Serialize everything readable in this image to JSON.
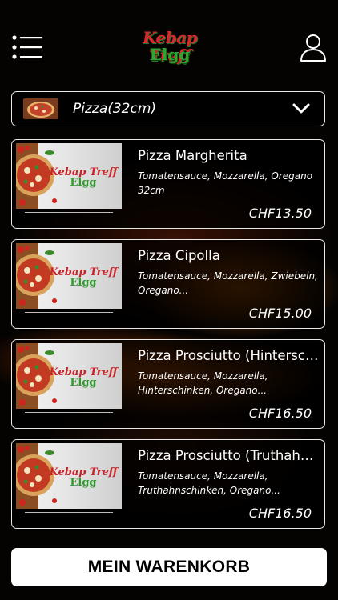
{
  "header": {
    "logo_line1": "Kebap Treff",
    "logo_line2": "Elgg",
    "menu_icon": "hamburger-list-icon",
    "user_icon": "user-icon"
  },
  "category": {
    "selected": "Pizza(32cm)",
    "icon": "chevron-down-icon"
  },
  "thumb_logo": {
    "line1": "Kebap Treff",
    "line2": "Elgg"
  },
  "products": [
    {
      "name": "Pizza Margherita",
      "description": "Tomatensauce, Mozzarella, Oregano 32cm",
      "price": "CHF13.50"
    },
    {
      "name": "Pizza Cipolla",
      "description": "Tomatensauce, Mozzarella, Zwiebeln, Oregano...",
      "price": "CHF15.00"
    },
    {
      "name": "Pizza Prosciutto (Hintersch...",
      "description": "Tomatensauce, Mozzarella, Hinterschinken, Oregano...",
      "price": "CHF16.50"
    },
    {
      "name": "Pizza Prosciutto (Truthahn...",
      "description": "Tomatensauce, Mozzarella, Truthahnschinken, Oregano...",
      "price": "CHF16.50"
    }
  ],
  "cart": {
    "label": "MEIN WARENKORB"
  },
  "colors": {
    "logo_red": "#d8262c",
    "logo_green": "#2fa52f",
    "border": "#e8e8e8"
  }
}
